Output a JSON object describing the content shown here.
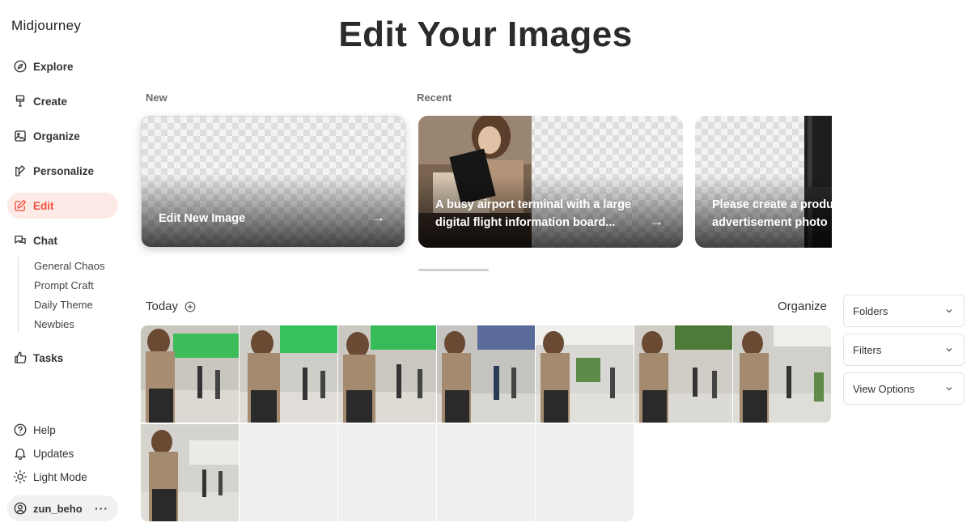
{
  "app": {
    "brand": "Midjourney"
  },
  "nav": {
    "explore": "Explore",
    "create": "Create",
    "organize": "Organize",
    "personalize": "Personalize",
    "edit": "Edit",
    "chat": "Chat",
    "chat_rooms": [
      "General Chaos",
      "Prompt Craft",
      "Daily Theme",
      "Newbies"
    ],
    "tasks": "Tasks",
    "help": "Help",
    "updates": "Updates",
    "light_mode": "Light Mode",
    "user": "zun_beho",
    "user_more": "···"
  },
  "page": {
    "title": "Edit Your Images"
  },
  "new_section": {
    "label": "New",
    "card_label": "Edit New Image",
    "arrow": "→"
  },
  "recent_section": {
    "label": "Recent",
    "cards": [
      {
        "line1": "A busy airport terminal with a large",
        "line2": "digital flight information board...",
        "arrow": "→"
      },
      {
        "line1": "Please create a produ",
        "line2": "advertisement photo"
      }
    ]
  },
  "today": {
    "label": "Today"
  },
  "organize_label": "Organize",
  "side_controls": {
    "folders": "Folders",
    "filters": "Filters",
    "view_options": "View Options"
  },
  "colors": {
    "accent": "#f0523e",
    "accent_bg": "#fde9e6",
    "board_green": "#2fbf57"
  },
  "icons": [
    "compass-icon",
    "brush-icon",
    "image-icon",
    "personalize-icon",
    "edit-icon",
    "chat-icon",
    "thumbs-up-icon",
    "help-icon",
    "bell-icon",
    "sun-icon",
    "user-icon",
    "plus-circle-icon",
    "chevron-down-icon",
    "arrow-right-icon"
  ]
}
